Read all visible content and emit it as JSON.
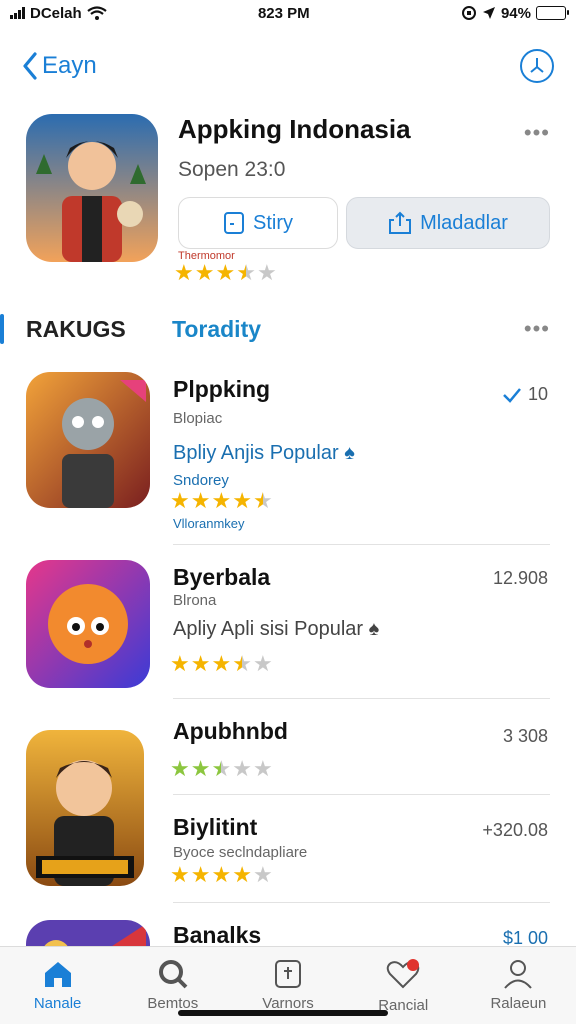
{
  "status_bar": {
    "carrier": "DCelah",
    "time": "823 PM",
    "battery": "94%",
    "battery_level": 0.94
  },
  "nav": {
    "back_label": "Eayn"
  },
  "hero": {
    "title": "Appking Indonasia",
    "subtitle": "Sopen 23:0",
    "story_button": "Stiry",
    "download_button": "Mladadlar",
    "caption": "Thermomor",
    "rating": 3.5
  },
  "section": {
    "title": "RAKUGS",
    "tab": "Toradity"
  },
  "apps": [
    {
      "name": "Plppking",
      "sub": "Blopiac",
      "tag": "Bpliy Anjis Popular",
      "sub2": "Sndorey",
      "rating": 4.5,
      "note": "Vlloranmkey",
      "value": "10"
    },
    {
      "name": "Byerbala",
      "sub": "Blrona",
      "tag": "Apliy Apli sisi Popular",
      "rating": 3.5,
      "value": "12.908"
    },
    {
      "name": "Apubhnbd",
      "rating": 2.5,
      "value": "3 308"
    },
    {
      "name": "Biylitint",
      "sub": "Byoce seclndapliare",
      "rating": 4.0,
      "value": "+320.08"
    },
    {
      "name": "Banalks",
      "value": "$1 00"
    }
  ],
  "tabs": [
    {
      "label": "Nanale",
      "icon": "home-icon"
    },
    {
      "label": "Bemtos",
      "icon": "search-icon"
    },
    {
      "label": "Varnors",
      "icon": "tag-icon"
    },
    {
      "label": "Rancial",
      "icon": "heart-icon"
    },
    {
      "label": "Ralaeun",
      "icon": "person-icon"
    }
  ],
  "colors": {
    "accent": "#1a7fd6",
    "star": "#f5b400",
    "star_green": "#8cc63f"
  }
}
